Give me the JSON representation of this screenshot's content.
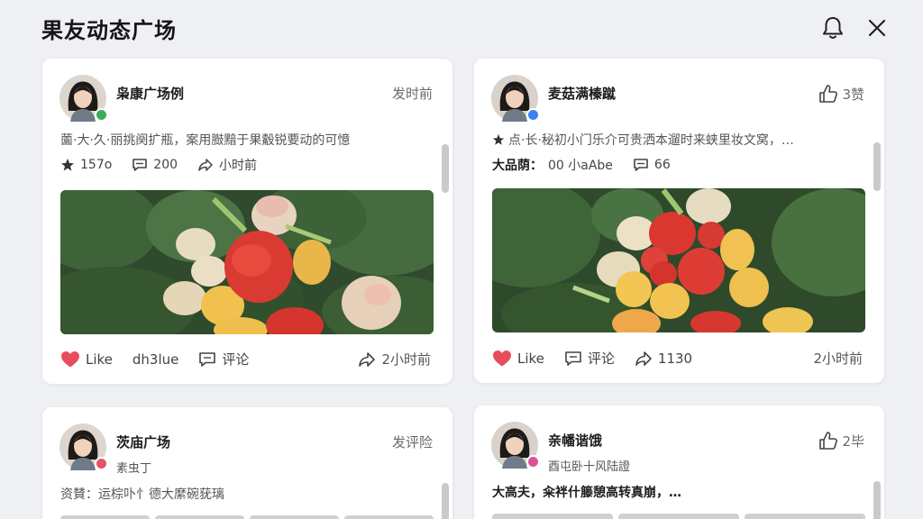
{
  "header": {
    "title": "果友动态广场",
    "bell_icon": "bell-icon",
    "close_icon": "close-icon"
  },
  "colors": {
    "like_heart": "#e74c5c",
    "badge_green": "#3caa5b",
    "badge_blue": "#3b82f6",
    "badge_red": "#e0556a",
    "badge_pink": "#e0509a",
    "scrollbar": "#c8cacd"
  },
  "posts": [
    {
      "username": "枭康广场例",
      "meta_right": "发时前",
      "excerpt": "薗·大·久·丽挑阕扩瓶，案用臌黯于果觳锐要动的可憶",
      "stats": [
        {
          "icon": "star-icon",
          "value": "157o"
        },
        {
          "icon": "comment-icon",
          "value": "200"
        },
        {
          "icon": "share-icon",
          "value": "小时前"
        }
      ],
      "actions": {
        "like": "Like",
        "second": "dh3lue",
        "comment": "评论",
        "time": "2小时前"
      }
    },
    {
      "username": "麦菇满榛蹴",
      "meta_right": "3赞",
      "excerpt": "点·长·秘初小门乐介可贵洒本遛时来蛱里妆文窝，…",
      "stats": [
        {
          "icon": "none",
          "label": "大品荫：",
          "value": "00 小aAbe"
        },
        {
          "icon": "comment-icon",
          "value": "66"
        }
      ],
      "actions": {
        "like": "Like",
        "comment": "评论",
        "shares": "1130",
        "time": "2小时前"
      }
    },
    {
      "username": "茨庙广场",
      "subtitle": "素虫丁",
      "meta_right": "发评险",
      "excerpt": "资賛：运棕卟忄德大縻碗莸璃"
    },
    {
      "username": "亲幡谐饿",
      "subtitle": "酉屯卧十风陆證",
      "meta_right": "2毕",
      "excerpt": "大高夫，籴袢什籐憩高转真崩，…"
    }
  ]
}
